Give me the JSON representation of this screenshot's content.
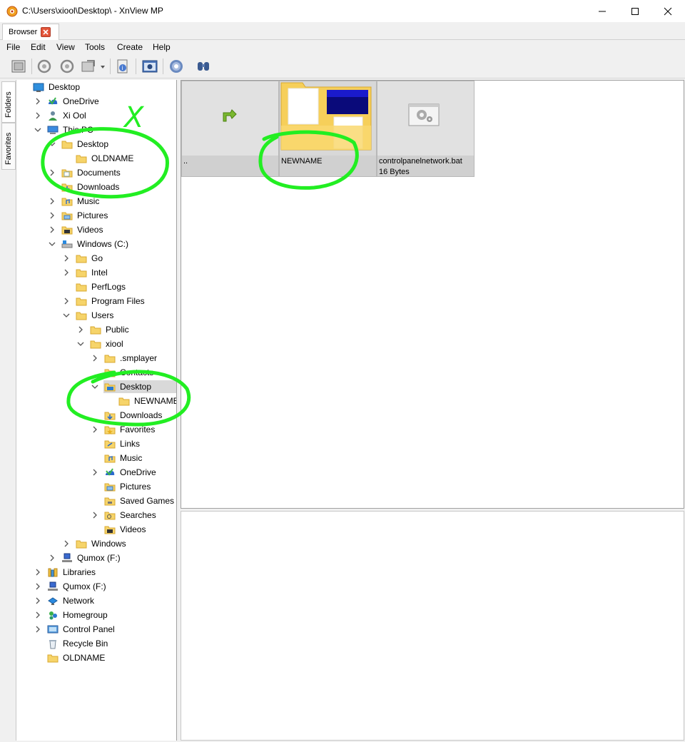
{
  "window": {
    "title": "C:\\Users\\xiool\\Desktop\\ - XnView MP"
  },
  "tabs": [
    {
      "label": "Browser"
    }
  ],
  "menu": [
    "File",
    "Edit",
    "View",
    "Tools",
    "Create",
    "Help"
  ],
  "toolbar": {
    "buttons": [
      "fullscreen-icon",
      "rotate-left-icon",
      "rotate-right-icon",
      "transform-icon",
      "info-icon",
      "capture-icon",
      "settings-icon",
      "find-icon"
    ]
  },
  "side_tabs": [
    "Folders",
    "Favorites"
  ],
  "tree": [
    {
      "label": "Desktop",
      "icon": "desktop-icon",
      "level": 0,
      "expander": "none"
    },
    {
      "label": "OneDrive",
      "icon": "onedrive-icon",
      "level": 1,
      "expander": "collapsed"
    },
    {
      "label": "Xi Ool",
      "icon": "user-icon",
      "level": 1,
      "expander": "collapsed"
    },
    {
      "label": "This PC",
      "icon": "pc-icon",
      "level": 1,
      "expander": "expanded"
    },
    {
      "label": "Desktop",
      "icon": "folder-icon",
      "level": 2,
      "expander": "expanded"
    },
    {
      "label": "OLDNAME",
      "icon": "folder-icon",
      "level": 3,
      "expander": "none"
    },
    {
      "label": "Documents",
      "icon": "documents-icon",
      "level": 2,
      "expander": "collapsed"
    },
    {
      "label": "Downloads",
      "icon": "downloads-icon",
      "level": 2,
      "expander": "none"
    },
    {
      "label": "Music",
      "icon": "music-icon",
      "level": 2,
      "expander": "collapsed"
    },
    {
      "label": "Pictures",
      "icon": "pictures-icon",
      "level": 2,
      "expander": "collapsed"
    },
    {
      "label": "Videos",
      "icon": "videos-icon",
      "level": 2,
      "expander": "collapsed"
    },
    {
      "label": "Windows (C:)",
      "icon": "drive-icon",
      "level": 2,
      "expander": "expanded"
    },
    {
      "label": "Go",
      "icon": "folder-icon",
      "level": 3,
      "expander": "collapsed"
    },
    {
      "label": "Intel",
      "icon": "folder-icon",
      "level": 3,
      "expander": "collapsed"
    },
    {
      "label": "PerfLogs",
      "icon": "folder-icon",
      "level": 3,
      "expander": "none"
    },
    {
      "label": "Program Files",
      "icon": "folder-icon",
      "level": 3,
      "expander": "collapsed"
    },
    {
      "label": "Users",
      "icon": "folder-icon",
      "level": 3,
      "expander": "expanded"
    },
    {
      "label": "Public",
      "icon": "folder-icon",
      "level": 4,
      "expander": "collapsed"
    },
    {
      "label": "xiool",
      "icon": "folder-icon",
      "level": 4,
      "expander": "expanded"
    },
    {
      "label": ".smplayer",
      "icon": "folder-icon",
      "level": 5,
      "expander": "collapsed"
    },
    {
      "label": "Contacts",
      "icon": "contacts-icon",
      "level": 5,
      "expander": "none"
    },
    {
      "label": "Desktop",
      "icon": "desktop-folder-icon",
      "level": 5,
      "expander": "expanded",
      "selected": true
    },
    {
      "label": "NEWNAME",
      "icon": "folder-icon",
      "level": 6,
      "expander": "none"
    },
    {
      "label": "Downloads",
      "icon": "downloads-icon",
      "level": 5,
      "expander": "none"
    },
    {
      "label": "Favorites",
      "icon": "favorites-icon",
      "level": 5,
      "expander": "collapsed"
    },
    {
      "label": "Links",
      "icon": "links-icon",
      "level": 5,
      "expander": "none"
    },
    {
      "label": "Music",
      "icon": "music-icon",
      "level": 5,
      "expander": "none"
    },
    {
      "label": "OneDrive",
      "icon": "onedrive-icon",
      "level": 5,
      "expander": "collapsed"
    },
    {
      "label": "Pictures",
      "icon": "pictures-icon",
      "level": 5,
      "expander": "none"
    },
    {
      "label": "Saved Games",
      "icon": "saved-games-icon",
      "level": 5,
      "expander": "none"
    },
    {
      "label": "Searches",
      "icon": "searches-icon",
      "level": 5,
      "expander": "collapsed"
    },
    {
      "label": "Videos",
      "icon": "videos-icon",
      "level": 5,
      "expander": "none"
    },
    {
      "label": "Windows",
      "icon": "folder-icon",
      "level": 3,
      "expander": "collapsed"
    },
    {
      "label": "Qumox (F:)",
      "icon": "network-drive-icon",
      "level": 2,
      "expander": "collapsed"
    },
    {
      "label": "Libraries",
      "icon": "libraries-icon",
      "level": 1,
      "expander": "collapsed"
    },
    {
      "label": "Qumox (F:)",
      "icon": "network-drive-icon",
      "level": 1,
      "expander": "collapsed"
    },
    {
      "label": "Network",
      "icon": "network-icon",
      "level": 1,
      "expander": "collapsed"
    },
    {
      "label": "Homegroup",
      "icon": "homegroup-icon",
      "level": 1,
      "expander": "collapsed"
    },
    {
      "label": "Control Panel",
      "icon": "control-panel-icon",
      "level": 1,
      "expander": "collapsed"
    },
    {
      "label": "Recycle Bin",
      "icon": "recycle-bin-icon",
      "level": 1,
      "expander": "none"
    },
    {
      "label": "OLDNAME",
      "icon": "folder-icon",
      "level": 1,
      "expander": "none"
    }
  ],
  "thumbnails": [
    {
      "name": "..",
      "size": "",
      "kind": "parent-folder-icon"
    },
    {
      "name": "NEWNAME",
      "size": "",
      "kind": "folder-preview-icon"
    },
    {
      "name": "controlpanelnetwork.bat",
      "size": "16 Bytes",
      "kind": "batch-file-icon"
    }
  ],
  "annotation": {
    "mark": "X",
    "color": "#22ee22"
  }
}
